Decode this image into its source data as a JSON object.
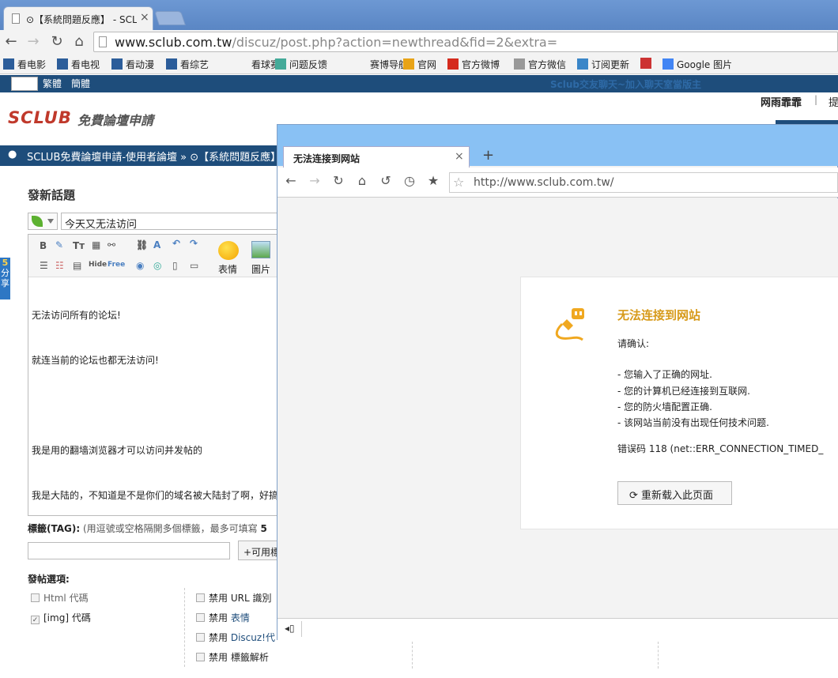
{
  "browser": {
    "tab_title": "⊙【系統問題反應】 - SCL",
    "tab_close": "×",
    "url_host": "www.sclub.com.tw",
    "url_path": "/discuz/post.php?action=newthread&fid=2&extra=",
    "bookmarks": [
      {
        "label": "看电影",
        "icon": "kankan-icon"
      },
      {
        "label": "看电视",
        "icon": "kankan-icon"
      },
      {
        "label": "看动漫",
        "icon": "kankan-icon"
      },
      {
        "label": "看综艺",
        "icon": "kankan-icon"
      },
      {
        "label": "看球赛",
        "icon": "blank-icon"
      },
      {
        "label": "问题反馈",
        "icon": "feedback-icon"
      },
      {
        "label": "赛博导航",
        "icon": "blank-icon"
      },
      {
        "label": "官网",
        "icon": "browser-icon"
      },
      {
        "label": "官方微博",
        "icon": "weibo-icon"
      },
      {
        "label": "官方微信",
        "icon": "page-icon"
      },
      {
        "label": "订阅更新",
        "icon": "rss-icon"
      },
      {
        "label": "",
        "icon": "game-icon"
      },
      {
        "label": "Google 图片",
        "icon": "google-icon"
      }
    ]
  },
  "site": {
    "lang_trad": "繁體",
    "lang_simp": "簡體",
    "top_notice": "Sclub交友聊天~加入聊天室當版主",
    "logo_main": "SCLUB",
    "logo_sub": "免費論壇申請",
    "username": "网雨霏霏",
    "separator": "|",
    "tip": "提",
    "breadcrumb": "SCLUB免費論壇申請-使用者論壇 » ⊙【系統問題反應】 »",
    "share": [
      "5",
      "分",
      "享"
    ]
  },
  "post": {
    "heading": "發新話題",
    "subject": "今天又无法访问",
    "toolbar": {
      "bold": "B",
      "font_size": "Tт",
      "emoticon_label": "表情",
      "image_label": "圖片",
      "hide_label": "Hide",
      "free_label": "Free"
    },
    "body_lines": [
      "无法访问所有的论坛!",
      "就连当前的论坛也都无法访问!",
      "",
      "我是用的翻墙浏览器才可以访问并发帖的",
      "我是大陆的，不知道是不是你们的域名被大陆封了啊，好搞"
    ],
    "tag_label": "標籤(TAG):",
    "tag_hint": "(用逗號或空格隔開多個標籤，最多可填寫",
    "tag_count": "5",
    "tag_button": "+可用標",
    "options_heading": "發帖選項:",
    "options_left": [
      {
        "label": "Html 代碼",
        "checked": false
      },
      {
        "label": "[img] 代碼",
        "checked": true
      }
    ],
    "options_right": [
      {
        "prefix": "禁用",
        "label": "URL 識別"
      },
      {
        "prefix": "禁用",
        "label": "表情"
      },
      {
        "prefix": "禁用",
        "label": "Discuz!代"
      },
      {
        "prefix": "禁用",
        "label": "標籤解析"
      }
    ]
  },
  "overlay": {
    "tab_title": "无法连接到网站",
    "tab_close": "×",
    "new_tab": "+",
    "url": "http://www.sclub.com.tw/",
    "error_title": "无法连接到网站",
    "confirm": "请确认:",
    "checks": [
      "- 您输入了正确的网址.",
      "- 您的计算机已经连接到互联网.",
      "- 您的防火墙配置正确.",
      "- 该网站当前没有出现任何技术问题."
    ],
    "error_code": "错误码 118 (net::ERR_CONNECTION_TIMED_",
    "reload_button": "重新载入此页面"
  },
  "colors": {
    "site_blue": "#1e4d7b",
    "overlay_tabbar": "#89c1f4",
    "error_title": "#d79a1a",
    "logo_red": "#c0392b"
  }
}
